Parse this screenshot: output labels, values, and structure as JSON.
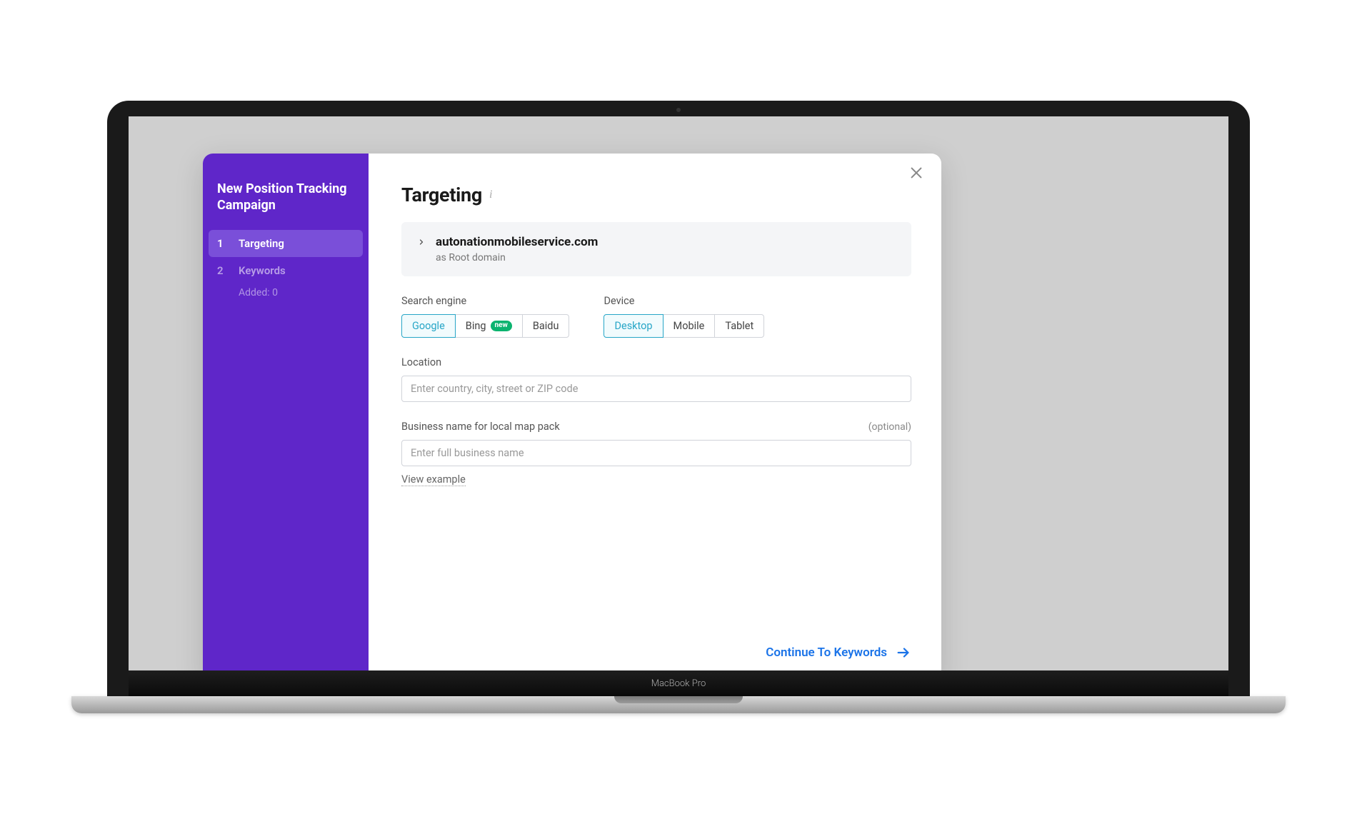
{
  "device": {
    "label": "MacBook Pro"
  },
  "sidebar": {
    "title": "New Position Tracking Campaign",
    "steps": [
      {
        "num": "1",
        "label": "Targeting",
        "active": true
      },
      {
        "num": "2",
        "label": "Keywords",
        "active": false,
        "sub": "Added: 0"
      }
    ]
  },
  "main": {
    "title": "Targeting",
    "domain": {
      "name": "autonationmobileservice.com",
      "sub": "as Root domain"
    },
    "searchEngine": {
      "label": "Search engine",
      "options": [
        {
          "label": "Google",
          "selected": true
        },
        {
          "label": "Bing",
          "badge": "new"
        },
        {
          "label": "Baidu"
        }
      ]
    },
    "deviceGroup": {
      "label": "Device",
      "options": [
        {
          "label": "Desktop",
          "selected": true
        },
        {
          "label": "Mobile"
        },
        {
          "label": "Tablet"
        }
      ]
    },
    "location": {
      "label": "Location",
      "placeholder": "Enter country, city, street or ZIP code"
    },
    "business": {
      "label": "Business name for local map pack",
      "optional": "(optional)",
      "placeholder": "Enter full business name",
      "viewExample": "View example"
    },
    "footer": {
      "continue": "Continue To Keywords"
    }
  }
}
